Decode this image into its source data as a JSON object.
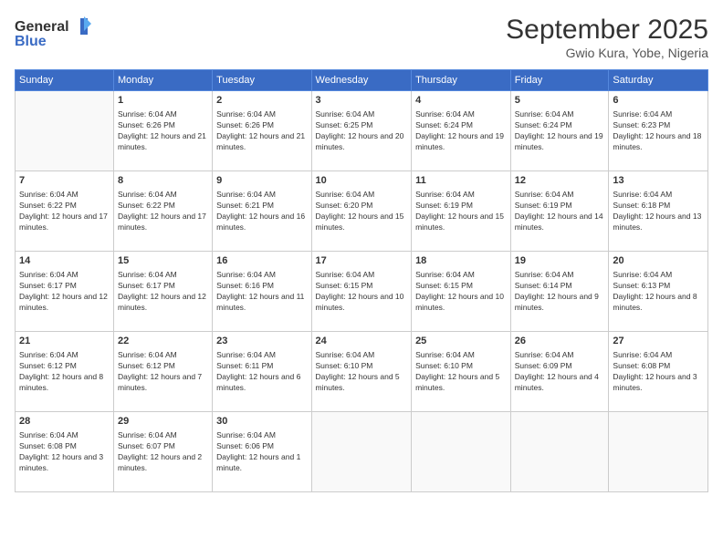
{
  "logo": {
    "line1": "General",
    "line2": "Blue"
  },
  "title": "September 2025",
  "subtitle": "Gwio Kura, Yobe, Nigeria",
  "days_of_week": [
    "Sunday",
    "Monday",
    "Tuesday",
    "Wednesday",
    "Thursday",
    "Friday",
    "Saturday"
  ],
  "weeks": [
    [
      {
        "day": "",
        "sunrise": "",
        "sunset": "",
        "daylight": "",
        "empty": true
      },
      {
        "day": "1",
        "sunrise": "6:04 AM",
        "sunset": "6:26 PM",
        "daylight": "12 hours and 21 minutes."
      },
      {
        "day": "2",
        "sunrise": "6:04 AM",
        "sunset": "6:26 PM",
        "daylight": "12 hours and 21 minutes."
      },
      {
        "day": "3",
        "sunrise": "6:04 AM",
        "sunset": "6:25 PM",
        "daylight": "12 hours and 20 minutes."
      },
      {
        "day": "4",
        "sunrise": "6:04 AM",
        "sunset": "6:24 PM",
        "daylight": "12 hours and 19 minutes."
      },
      {
        "day": "5",
        "sunrise": "6:04 AM",
        "sunset": "6:24 PM",
        "daylight": "12 hours and 19 minutes."
      },
      {
        "day": "6",
        "sunrise": "6:04 AM",
        "sunset": "6:23 PM",
        "daylight": "12 hours and 18 minutes."
      }
    ],
    [
      {
        "day": "7",
        "sunrise": "6:04 AM",
        "sunset": "6:22 PM",
        "daylight": "12 hours and 17 minutes."
      },
      {
        "day": "8",
        "sunrise": "6:04 AM",
        "sunset": "6:22 PM",
        "daylight": "12 hours and 17 minutes."
      },
      {
        "day": "9",
        "sunrise": "6:04 AM",
        "sunset": "6:21 PM",
        "daylight": "12 hours and 16 minutes."
      },
      {
        "day": "10",
        "sunrise": "6:04 AM",
        "sunset": "6:20 PM",
        "daylight": "12 hours and 15 minutes."
      },
      {
        "day": "11",
        "sunrise": "6:04 AM",
        "sunset": "6:19 PM",
        "daylight": "12 hours and 15 minutes."
      },
      {
        "day": "12",
        "sunrise": "6:04 AM",
        "sunset": "6:19 PM",
        "daylight": "12 hours and 14 minutes."
      },
      {
        "day": "13",
        "sunrise": "6:04 AM",
        "sunset": "6:18 PM",
        "daylight": "12 hours and 13 minutes."
      }
    ],
    [
      {
        "day": "14",
        "sunrise": "6:04 AM",
        "sunset": "6:17 PM",
        "daylight": "12 hours and 12 minutes."
      },
      {
        "day": "15",
        "sunrise": "6:04 AM",
        "sunset": "6:17 PM",
        "daylight": "12 hours and 12 minutes."
      },
      {
        "day": "16",
        "sunrise": "6:04 AM",
        "sunset": "6:16 PM",
        "daylight": "12 hours and 11 minutes."
      },
      {
        "day": "17",
        "sunrise": "6:04 AM",
        "sunset": "6:15 PM",
        "daylight": "12 hours and 10 minutes."
      },
      {
        "day": "18",
        "sunrise": "6:04 AM",
        "sunset": "6:15 PM",
        "daylight": "12 hours and 10 minutes."
      },
      {
        "day": "19",
        "sunrise": "6:04 AM",
        "sunset": "6:14 PM",
        "daylight": "12 hours and 9 minutes."
      },
      {
        "day": "20",
        "sunrise": "6:04 AM",
        "sunset": "6:13 PM",
        "daylight": "12 hours and 8 minutes."
      }
    ],
    [
      {
        "day": "21",
        "sunrise": "6:04 AM",
        "sunset": "6:12 PM",
        "daylight": "12 hours and 8 minutes."
      },
      {
        "day": "22",
        "sunrise": "6:04 AM",
        "sunset": "6:12 PM",
        "daylight": "12 hours and 7 minutes."
      },
      {
        "day": "23",
        "sunrise": "6:04 AM",
        "sunset": "6:11 PM",
        "daylight": "12 hours and 6 minutes."
      },
      {
        "day": "24",
        "sunrise": "6:04 AM",
        "sunset": "6:10 PM",
        "daylight": "12 hours and 5 minutes."
      },
      {
        "day": "25",
        "sunrise": "6:04 AM",
        "sunset": "6:10 PM",
        "daylight": "12 hours and 5 minutes."
      },
      {
        "day": "26",
        "sunrise": "6:04 AM",
        "sunset": "6:09 PM",
        "daylight": "12 hours and 4 minutes."
      },
      {
        "day": "27",
        "sunrise": "6:04 AM",
        "sunset": "6:08 PM",
        "daylight": "12 hours and 3 minutes."
      }
    ],
    [
      {
        "day": "28",
        "sunrise": "6:04 AM",
        "sunset": "6:08 PM",
        "daylight": "12 hours and 3 minutes."
      },
      {
        "day": "29",
        "sunrise": "6:04 AM",
        "sunset": "6:07 PM",
        "daylight": "12 hours and 2 minutes."
      },
      {
        "day": "30",
        "sunrise": "6:04 AM",
        "sunset": "6:06 PM",
        "daylight": "12 hours and 1 minute."
      },
      {
        "day": "",
        "sunrise": "",
        "sunset": "",
        "daylight": "",
        "empty": true
      },
      {
        "day": "",
        "sunrise": "",
        "sunset": "",
        "daylight": "",
        "empty": true
      },
      {
        "day": "",
        "sunrise": "",
        "sunset": "",
        "daylight": "",
        "empty": true
      },
      {
        "day": "",
        "sunrise": "",
        "sunset": "",
        "daylight": "",
        "empty": true
      }
    ]
  ],
  "labels": {
    "sunrise_prefix": "Sunrise: ",
    "sunset_prefix": "Sunset: ",
    "daylight_prefix": "Daylight: "
  }
}
